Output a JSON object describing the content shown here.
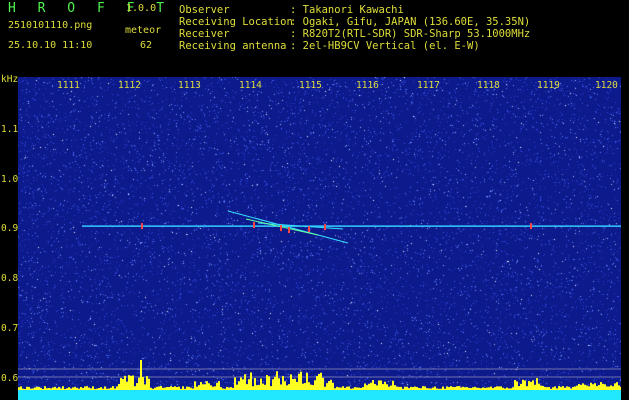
{
  "header": {
    "logo": "H R O F F T",
    "version": "1.0.0",
    "filename": "2510101110.png",
    "meteor_label": "meteor",
    "datetime": "25.10.10 11:10",
    "meteor_count": "62",
    "info": [
      {
        "key": "Observer",
        "value": ": Takanori Kawachi"
      },
      {
        "key": "Receiving Location",
        "value": ": Ogaki, Gifu, JAPAN (136.60E, 35.35N)"
      },
      {
        "key": "Receiver",
        "value": ": R820T2(RTL-SDR) SDR-Sharp 53.1000MHz"
      },
      {
        "key": "Receiving antenna",
        "value": ": 2el-HB9CV Vertical (el. E-W)"
      }
    ]
  },
  "spectrogram": {
    "y_unit": "kHz",
    "y_ticks": [
      "1.1",
      "1.0",
      "0.9",
      "0.8",
      "0.7",
      "0.6"
    ],
    "x_ticks": [
      "1111",
      "1112",
      "1113",
      "1114",
      "1115",
      "1116",
      "1117",
      "1118",
      "1119",
      "1120"
    ],
    "carrier_khz": 0.905,
    "colors": {
      "background": "#0d1a8c",
      "text": "#dede3a",
      "logo": "#4ff24f",
      "carrier": "#33ccff",
      "bars": "#ffff22",
      "floor": "#22e8ff"
    }
  }
}
